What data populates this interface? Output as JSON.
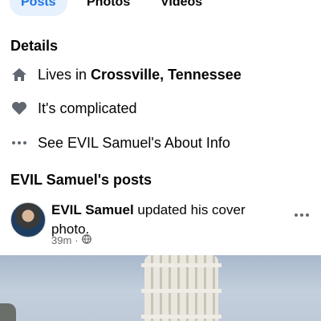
{
  "tabs": [
    {
      "label": "Posts",
      "active": true
    },
    {
      "label": "Photos",
      "active": false
    },
    {
      "label": "Videos",
      "active": false
    }
  ],
  "details": {
    "title": "Details",
    "lives_prefix": "Lives in ",
    "lives_location": "Crossville, Tennessee",
    "relationship": "It's complicated",
    "about_link": "See EVIL Samuel's About Info"
  },
  "posts": {
    "title": "EVIL Samuel's posts",
    "item": {
      "author": "EVIL Samuel",
      "action": " updated his cover photo.",
      "time": "39m",
      "separator": "·",
      "audience_icon": "globe-icon"
    }
  },
  "colors": {
    "accent": "#1b74e4",
    "tab_active_bg": "#e7f0fd",
    "secondary_text": "#65676b",
    "icon_gray": "#606770"
  }
}
